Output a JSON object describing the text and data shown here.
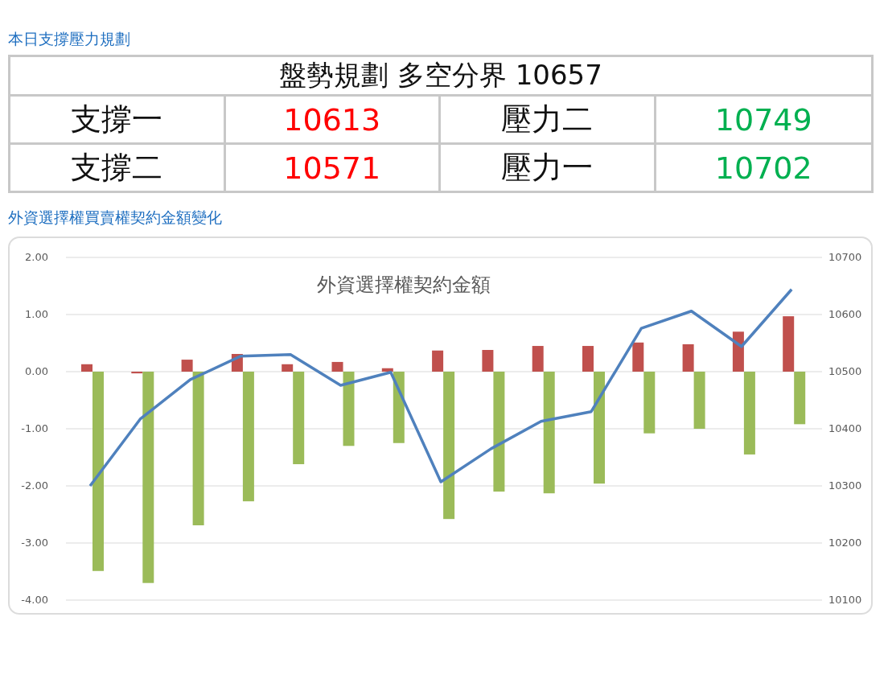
{
  "plan_heading": "本日支撐壓力規劃",
  "plan_table": {
    "title": "盤勢規劃 多空分界 10657",
    "rows": [
      [
        {
          "label": "支撐一",
          "value": "10613",
          "kind": "support"
        },
        {
          "label": "壓力二",
          "value": "10749",
          "kind": "resistance"
        }
      ],
      [
        {
          "label": "支撐二",
          "value": "10571",
          "kind": "support"
        },
        {
          "label": "壓力一",
          "value": "10702",
          "kind": "resistance"
        }
      ]
    ]
  },
  "chart_heading": "外資選擇權買賣權契約金額變化",
  "chart": {
    "chart_data": {
      "type": "bar",
      "title": "外資選擇權契約金額",
      "grid": true,
      "ylim": [
        -4,
        2
      ],
      "yticks": [
        {
          "value": 2,
          "label": "2.00"
        },
        {
          "value": 1,
          "label": "1.00"
        },
        {
          "value": 0,
          "label": "0.00"
        },
        {
          "value": -1,
          "label": "-1.00"
        },
        {
          "value": -2,
          "label": "-2.00"
        },
        {
          "value": -3,
          "label": "-3.00"
        },
        {
          "value": -4,
          "label": "-4.00"
        }
      ],
      "y2lim": [
        10100,
        10700
      ],
      "y2ticks": [
        10700,
        10600,
        10500,
        10400,
        10300,
        10200,
        10100
      ],
      "series": [
        {
          "color": "#c0504d",
          "values": [
            0.13,
            -0.03,
            0.21,
            0.31,
            0.13,
            0.17,
            0.06,
            0.37,
            0.38,
            0.45,
            0.45,
            0.51,
            0.48,
            0.7,
            0.97
          ]
        },
        {
          "color": "#9bbb59",
          "values": [
            -3.49,
            -3.7,
            -2.69,
            -2.27,
            -1.62,
            -1.3,
            -1.25,
            -2.58,
            -2.1,
            -2.13,
            -1.96,
            -1.08,
            -1.0,
            -1.45,
            -0.92
          ]
        },
        {
          "type": "line",
          "axis": "y2",
          "color": "#4f81bd",
          "values": [
            10300,
            10417,
            10486,
            10527,
            10530,
            10476,
            10499,
            10307,
            10365,
            10413,
            10430,
            10576,
            10606,
            10544,
            10644
          ]
        }
      ]
    }
  }
}
